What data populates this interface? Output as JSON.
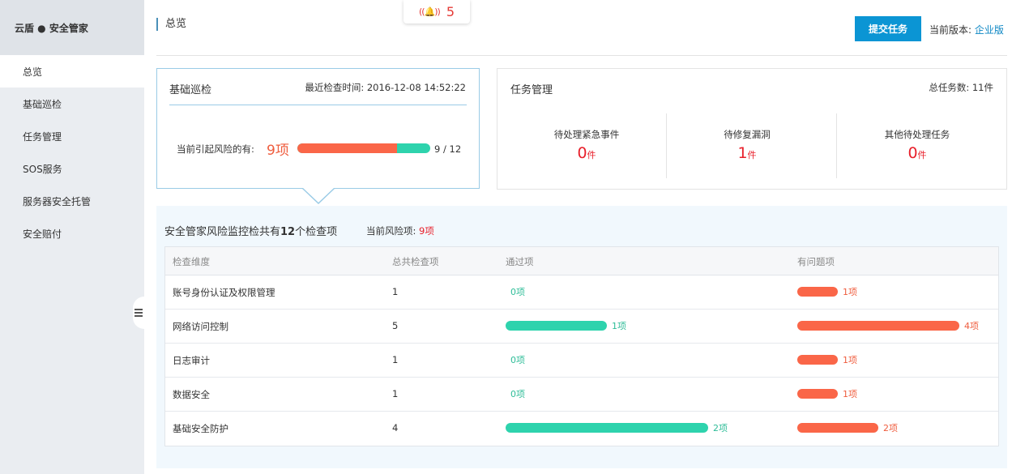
{
  "sidebar": {
    "brand": "云盾 ● 安全管家",
    "items": [
      {
        "label": "总览",
        "active": true
      },
      {
        "label": "基础巡检"
      },
      {
        "label": "任务管理"
      },
      {
        "label": "SOS服务"
      },
      {
        "label": "服务器安全托管"
      },
      {
        "label": "安全赔付"
      }
    ]
  },
  "header": {
    "title": "总览",
    "alarm_count": "5",
    "submit_label": "提交任务",
    "version_label": "当前版本:",
    "version_value": "企业版"
  },
  "basic_check": {
    "title": "基础巡检",
    "last_check": "最近检查时间: 2016-12-08 14:52:22",
    "risk_label": "当前引起风险的有:",
    "risk_count": "9项",
    "ratio": "9 / 12",
    "risk_fraction": 0.75
  },
  "task_mgmt": {
    "title": "任务管理",
    "total": "总任务数: 11件",
    "stats": [
      {
        "label": "待处理紧急事件",
        "value": "0",
        "unit": "件"
      },
      {
        "label": "待修复漏洞",
        "value": "1",
        "unit": "件"
      },
      {
        "label": "其他待处理任务",
        "value": "0",
        "unit": "件"
      }
    ]
  },
  "monitor": {
    "title_prefix": "安全管家风险监控检共有",
    "title_count": "12",
    "title_suffix": "个检查项",
    "risk_label": "当前风险项:",
    "risk_value": "9项",
    "columns": [
      "检查维度",
      "总共检查项",
      "通过项",
      "有问题项"
    ],
    "rows": [
      {
        "name": "账号身份认证及权限管理",
        "total": "1",
        "pass": 0,
        "pass_label": "0项",
        "fail": 1,
        "fail_label": "1项"
      },
      {
        "name": "网络访问控制",
        "total": "5",
        "pass": 1,
        "pass_label": "1项",
        "fail": 4,
        "fail_label": "4项"
      },
      {
        "name": "日志审计",
        "total": "1",
        "pass": 0,
        "pass_label": "0项",
        "fail": 1,
        "fail_label": "1项"
      },
      {
        "name": "数据安全",
        "total": "1",
        "pass": 0,
        "pass_label": "0项",
        "fail": 1,
        "fail_label": "1项"
      },
      {
        "name": "基础安全防护",
        "total": "4",
        "pass": 2,
        "pass_label": "2项",
        "fail": 2,
        "fail_label": "2项"
      }
    ]
  },
  "colors": {
    "accent": "#0b95d4",
    "pass": "#2ed3ad",
    "fail": "#fa6648",
    "danger": "#e8202b"
  }
}
